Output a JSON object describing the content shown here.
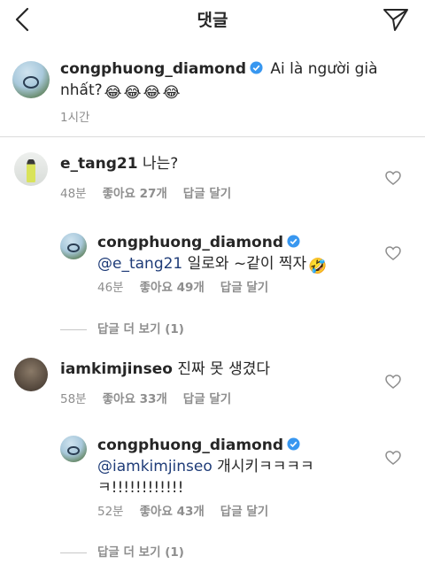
{
  "header": {
    "title": "댓글",
    "back_icon": "chevron-left-icon",
    "share_icon": "send-icon"
  },
  "caption": {
    "username": "congphuong_diamond",
    "text": "Ai là người già nhất?",
    "emojis": [
      "😂",
      "😂",
      "😂",
      "😂"
    ],
    "time": "1시간"
  },
  "comments": [
    {
      "username": "e_tang21",
      "text": "나는?",
      "time": "48분",
      "likes": "좋아요 27개",
      "reply": "답글 달기"
    },
    {
      "username": "congphuong_diamond",
      "mention": "@e_tang21",
      "text": " 일로와 ~같이 찍자",
      "emoji": "🤣",
      "time": "46분",
      "likes": "좋아요 49개",
      "reply": "답글 달기"
    },
    {
      "username": "iamkimjinseo",
      "text": "진짜 못 생겼다",
      "time": "58분",
      "likes": "좋아요 33개",
      "reply": "답글 달기"
    },
    {
      "username": "congphuong_diamond",
      "mention": "@iamkimjinseo",
      "text": " 개시키ㅋㅋㅋㅋ",
      "text2": "ㅋ!!!!!!!!!!!!",
      "time": "52분",
      "likes": "좋아요 43개",
      "reply": "답글 달기"
    }
  ],
  "view_more_1": "답글 더 보기 (1)",
  "view_more_2": "답글 더 보기 (1)",
  "colors": {
    "text": "#262626",
    "meta": "#8e8e8e",
    "mention": "#1f3c78",
    "verified": "#3897f0"
  }
}
